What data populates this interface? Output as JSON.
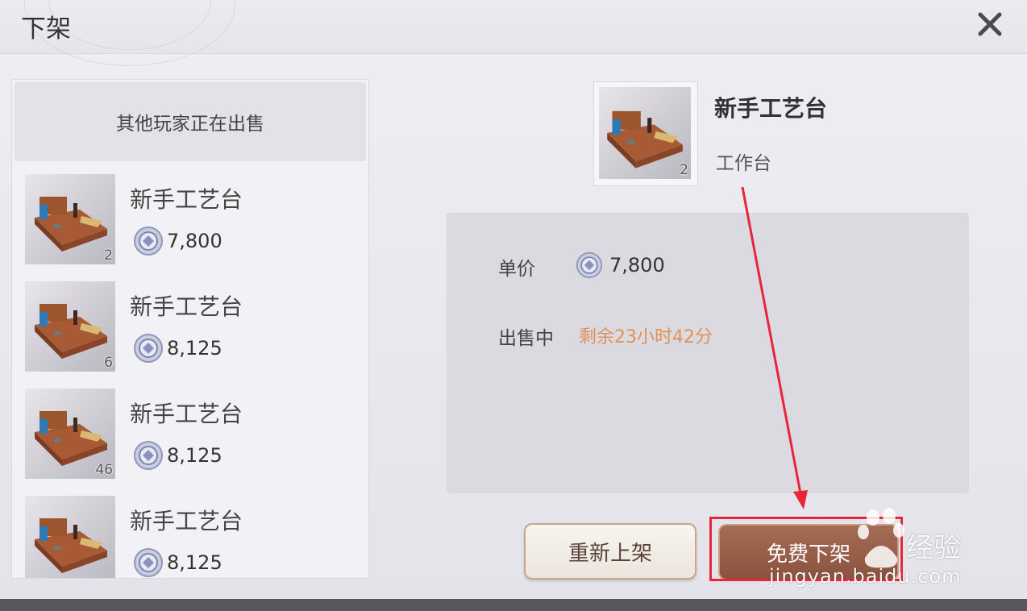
{
  "header": {
    "title": "下架"
  },
  "market": {
    "header": "其他玩家正在出售",
    "listings": [
      {
        "name": "新手工艺台",
        "price": "7,800",
        "qty": "2"
      },
      {
        "name": "新手工艺台",
        "price": "8,125",
        "qty": "6"
      },
      {
        "name": "新手工艺台",
        "price": "8,125",
        "qty": "46"
      },
      {
        "name": "新手工艺台",
        "price": "8,125",
        "qty": ""
      }
    ]
  },
  "detail": {
    "name": "新手工艺台",
    "type": "工作台",
    "qty": "2",
    "unit_price_label": "单价",
    "unit_price": "7,800",
    "status_label": "出售中",
    "time_left": "剩余23小时42分"
  },
  "buttons": {
    "relist": "重新上架",
    "delist": "免费下架"
  },
  "watermark": {
    "brand": "经验",
    "url": "jingyan.baidu.com"
  },
  "colors": {
    "accent_orange": "#e0915a",
    "delist_brown": "#8b533e",
    "highlight_red": "#e8253a"
  }
}
